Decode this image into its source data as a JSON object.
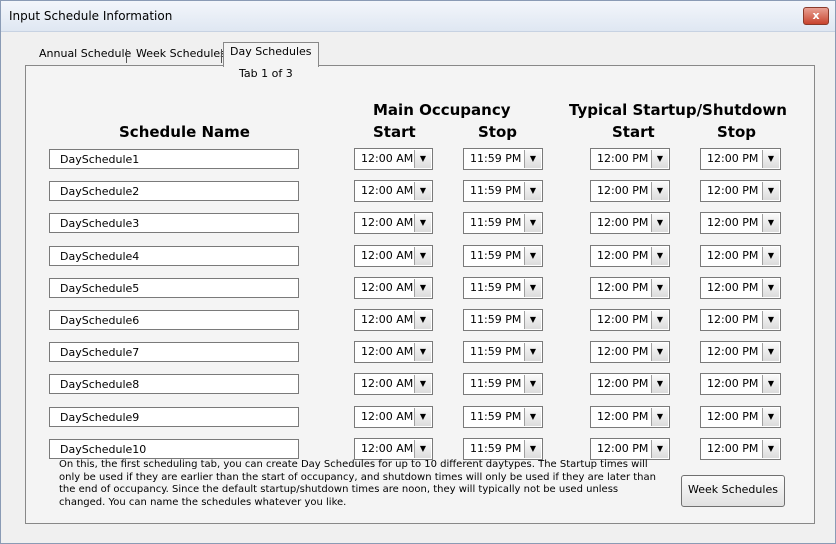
{
  "window": {
    "title": "Input Schedule Information",
    "close_label": "x"
  },
  "tabs": [
    "Annual Schedule",
    "Week Schedules",
    "Day Schedules"
  ],
  "tab_sub": "Tab 1 of 3",
  "headers": {
    "schedule_name": "Schedule Name",
    "main_occupancy": "Main Occupancy",
    "typical": "Typical Startup/Shutdown",
    "start": "Start",
    "stop": "Stop"
  },
  "rows": [
    {
      "name": "DaySchedule1",
      "occ_start": "12:00 AM",
      "occ_stop": "11:59 PM",
      "typ_start": "12:00 PM",
      "typ_stop": "12:00 PM"
    },
    {
      "name": "DaySchedule2",
      "occ_start": "12:00 AM",
      "occ_stop": "11:59 PM",
      "typ_start": "12:00 PM",
      "typ_stop": "12:00 PM"
    },
    {
      "name": "DaySchedule3",
      "occ_start": "12:00 AM",
      "occ_stop": "11:59 PM",
      "typ_start": "12:00 PM",
      "typ_stop": "12:00 PM"
    },
    {
      "name": "DaySchedule4",
      "occ_start": "12:00 AM",
      "occ_stop": "11:59 PM",
      "typ_start": "12:00 PM",
      "typ_stop": "12:00 PM"
    },
    {
      "name": "DaySchedule5",
      "occ_start": "12:00 AM",
      "occ_stop": "11:59 PM",
      "typ_start": "12:00 PM",
      "typ_stop": "12:00 PM"
    },
    {
      "name": "DaySchedule6",
      "occ_start": "12:00 AM",
      "occ_stop": "11:59 PM",
      "typ_start": "12:00 PM",
      "typ_stop": "12:00 PM"
    },
    {
      "name": "DaySchedule7",
      "occ_start": "12:00 AM",
      "occ_stop": "11:59 PM",
      "typ_start": "12:00 PM",
      "typ_stop": "12:00 PM"
    },
    {
      "name": "DaySchedule8",
      "occ_start": "12:00 AM",
      "occ_stop": "11:59 PM",
      "typ_start": "12:00 PM",
      "typ_stop": "12:00 PM"
    },
    {
      "name": "DaySchedule9",
      "occ_start": "12:00 AM",
      "occ_stop": "11:59 PM",
      "typ_start": "12:00 PM",
      "typ_stop": "12:00 PM"
    },
    {
      "name": "DaySchedule10",
      "occ_start": "12:00 AM",
      "occ_stop": "11:59 PM",
      "typ_start": "12:00 PM",
      "typ_stop": "12:00 PM"
    }
  ],
  "note": "On this, the first scheduling tab, you can create Day Schedules for up to 10 different daytypes.  The Startup times will only be used if they are earlier than the start of occupancy, and shutdown times will only be used if they are later than the end of occupancy.  Since the default startup/shutdown times are noon, they will typically not be used unless changed.  You can name the schedules whatever you like.",
  "week_button": "Week Schedules",
  "icons": {
    "close": "close-icon",
    "dropdown": "chevron-down-icon"
  }
}
